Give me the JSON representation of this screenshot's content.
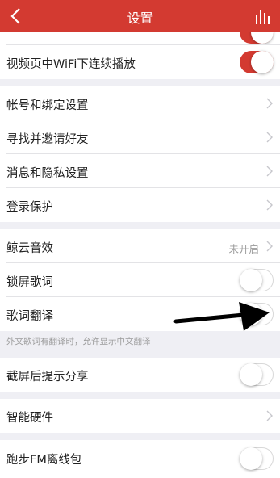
{
  "header": {
    "title": "设置",
    "back_icon": "chevron-left-icon",
    "stats_icon": "bar-chart-icon",
    "bg_color": "#d33a31"
  },
  "rows": {
    "wifi_autoplay": {
      "label": "视频页中WiFi下连续播放",
      "toggle": "on"
    },
    "account_binding": {
      "label": "帐号和绑定设置"
    },
    "invite_friends": {
      "label": "寻找并邀请好友"
    },
    "message_privacy": {
      "label": "消息和隐私设置"
    },
    "login_protection": {
      "label": "登录保护"
    },
    "whale_sound": {
      "label": "鲸云音效",
      "value": "未开启"
    },
    "lock_lyrics": {
      "label": "锁屏歌词",
      "toggle": "off"
    },
    "lyrics_translation": {
      "label": "歌词翻译",
      "toggle": "off"
    },
    "screenshot_share": {
      "label": "截屏后提示分享",
      "toggle": "off"
    },
    "smart_hardware": {
      "label": "智能硬件"
    },
    "running_fm": {
      "label": "跑步FM离线包",
      "toggle": "off"
    }
  },
  "lyrics_translation_hint": "外文歌词有翻译时，允许显示中文翻译",
  "accent_color": "#d33a31"
}
